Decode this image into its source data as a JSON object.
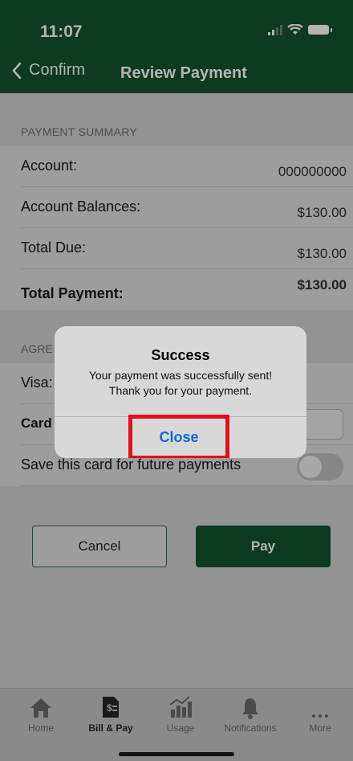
{
  "status_bar": {
    "time": "11:07"
  },
  "nav": {
    "back_label": "Confirm",
    "title": "Review Payment"
  },
  "summary": {
    "header": "PAYMENT SUMMARY",
    "rows": [
      {
        "label": "Account:",
        "value": "000000000"
      },
      {
        "label": "Account Balances:",
        "value": "$130.00"
      },
      {
        "label": "Total Due:",
        "value": "$130.00"
      },
      {
        "label": "Total Payment:",
        "value": "$130.00"
      }
    ]
  },
  "agreement": {
    "header": "AGRE",
    "card_row_label": "Visa:",
    "cvv_row_label": "Card",
    "save_card_label": "Save this card for future payments",
    "save_card_enabled": false
  },
  "buttons": {
    "cancel": "Cancel",
    "pay": "Pay"
  },
  "alert": {
    "title": "Success",
    "message_line1": "Your payment was successfully sent!",
    "message_line2": "Thank you for your payment.",
    "close": "Close"
  },
  "tabs": [
    {
      "label": "Home",
      "icon": "home-icon"
    },
    {
      "label": "Bill & Pay",
      "icon": "bill-icon"
    },
    {
      "label": "Usage",
      "icon": "usage-chart-icon"
    },
    {
      "label": "Notifications",
      "icon": "bell-icon"
    },
    {
      "label": "More",
      "icon": "more-dots-icon"
    }
  ],
  "colors": {
    "brand_green": "#0d3a20",
    "alert_link": "#0a6ad6",
    "highlight_red": "#e0101b"
  }
}
